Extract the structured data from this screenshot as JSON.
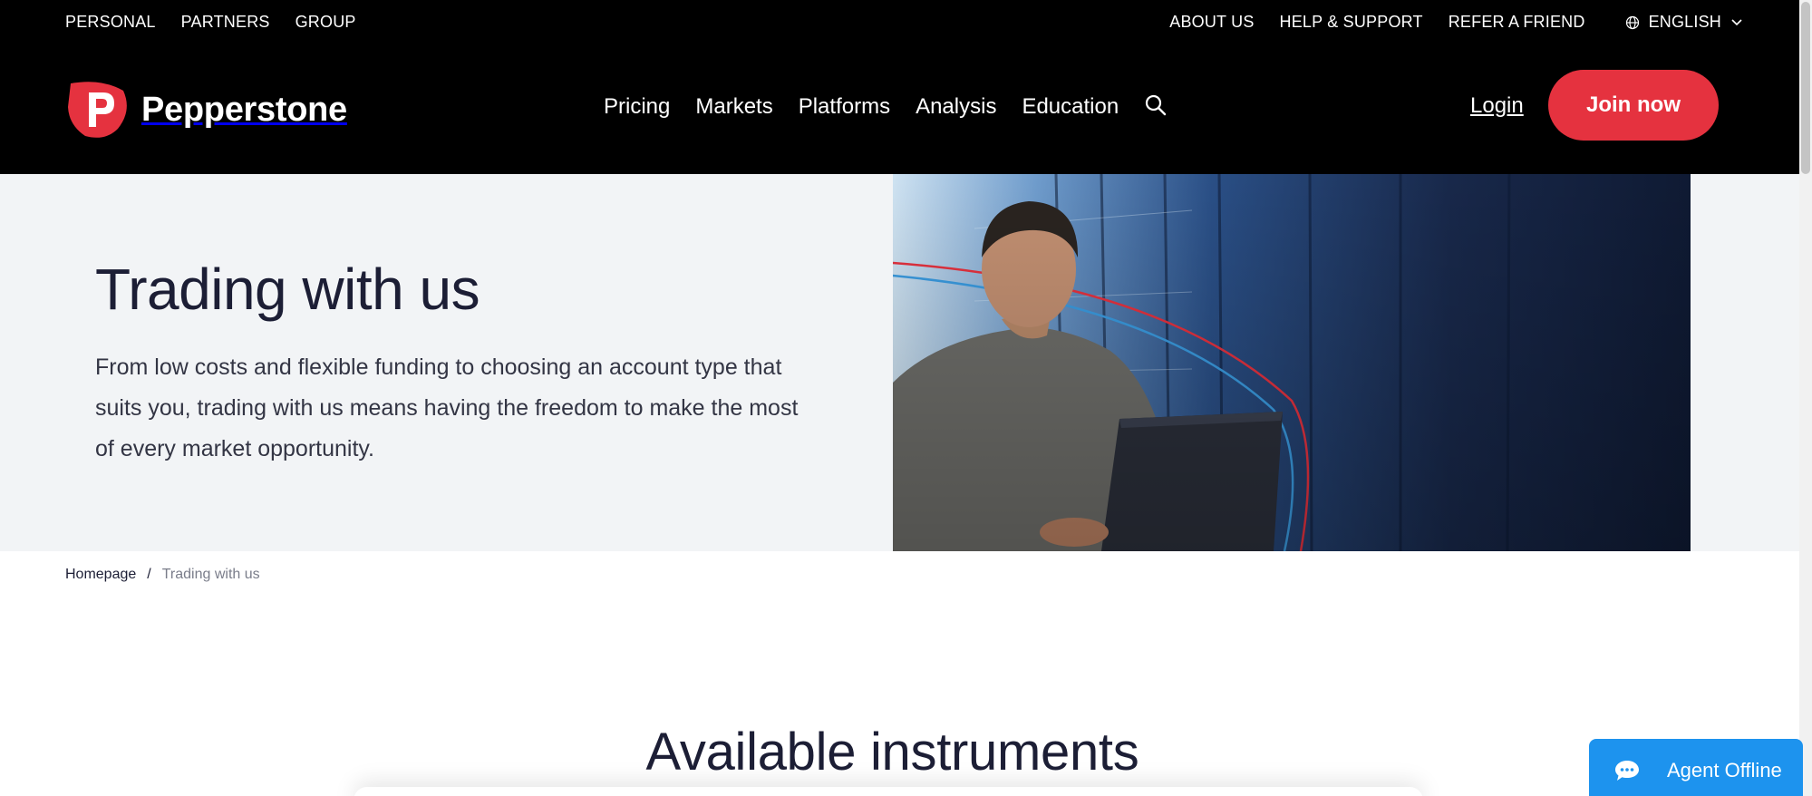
{
  "colors": {
    "header_bg": "#000000",
    "accent_red": "#e5323f",
    "hero_bg": "#f2f4f6",
    "chat_blue": "#1d93ee",
    "text_dark": "#1c1e35"
  },
  "topbar": {
    "left": [
      "PERSONAL",
      "PARTNERS",
      "GROUP"
    ],
    "right": [
      "ABOUT US",
      "HELP & SUPPORT",
      "REFER A FRIEND"
    ],
    "language": "ENGLISH",
    "language_icon": "globe-icon",
    "language_chevron_icon": "chevron-down-icon"
  },
  "brand": {
    "name": "Pepperstone",
    "logo_icon": "pepperstone-logo-icon"
  },
  "nav": {
    "items": [
      "Pricing",
      "Markets",
      "Platforms",
      "Analysis",
      "Education"
    ],
    "search_icon": "search-icon",
    "login": "Login",
    "join": "Join now"
  },
  "hero": {
    "title": "Trading with us",
    "text": "From low costs and flexible funding to choosing an account type that suits you, trading with us means having the freedom to make the most of every market opportunity."
  },
  "breadcrumb": {
    "home": "Homepage",
    "separator": "/",
    "current": "Trading with us"
  },
  "section": {
    "title": "Available instruments"
  },
  "chat": {
    "label": "Agent Offline",
    "icon": "chat-bubble-icon"
  }
}
